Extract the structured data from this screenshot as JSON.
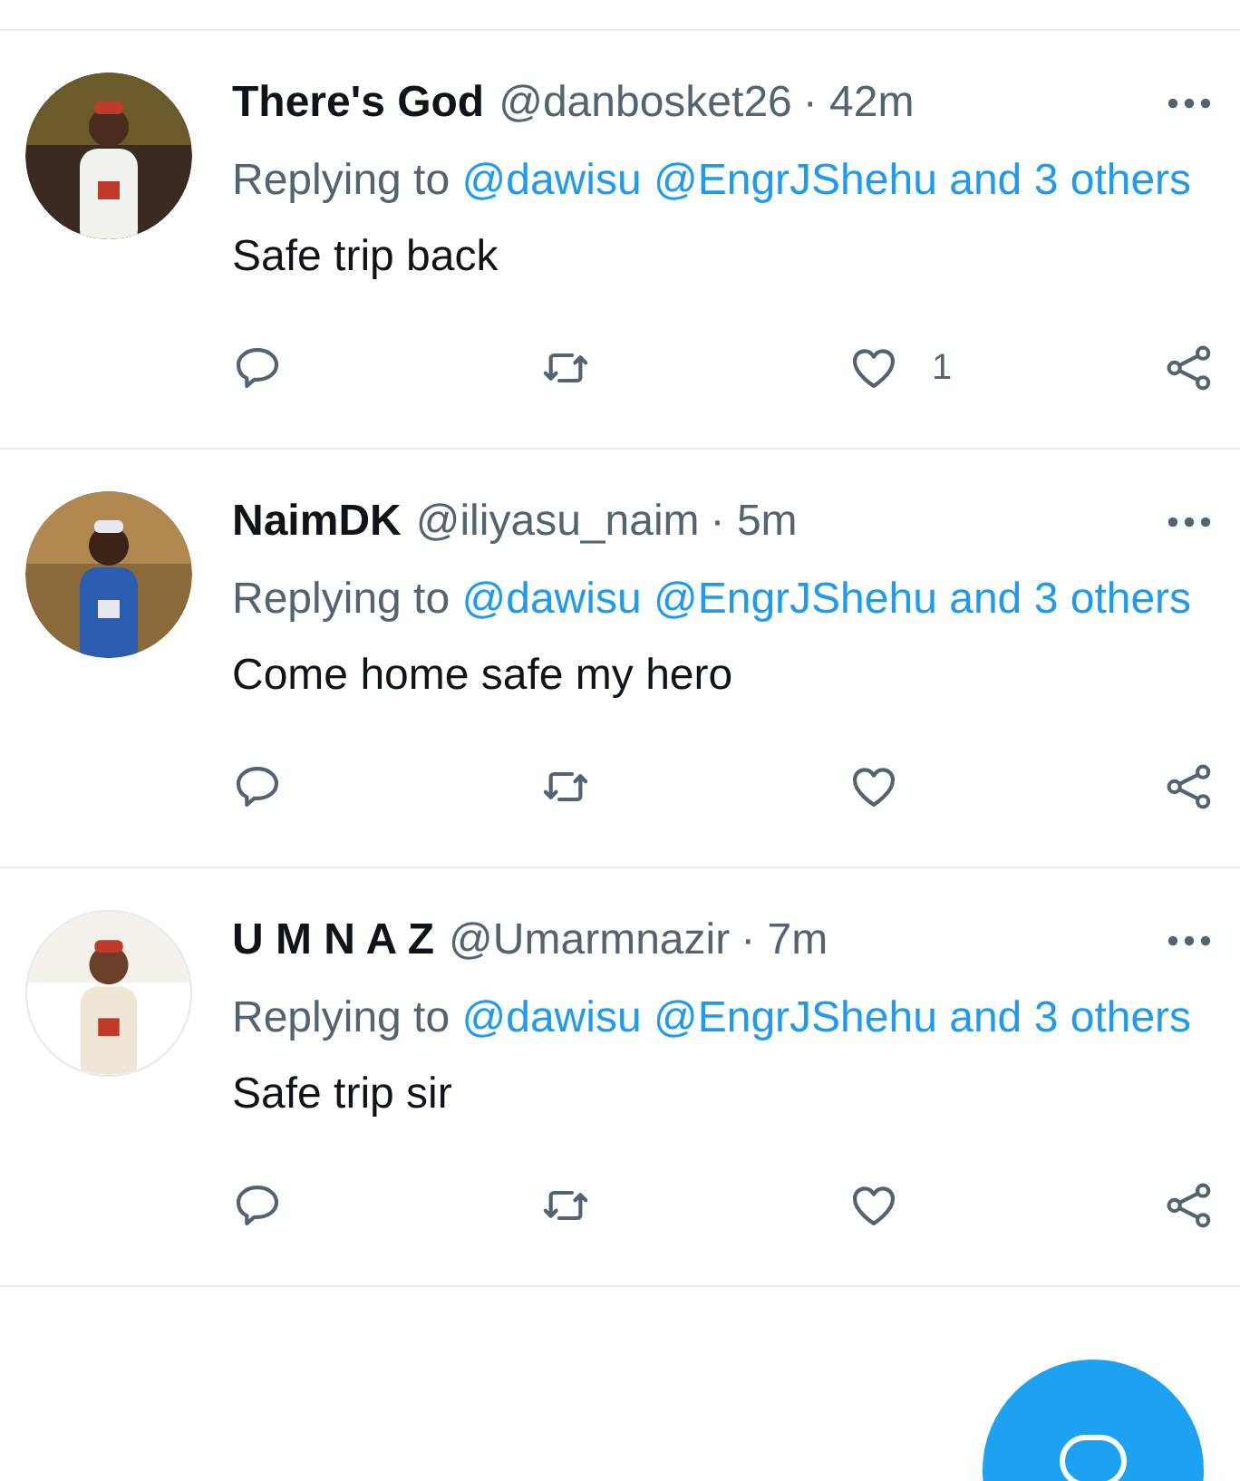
{
  "tweets": [
    {
      "name": "There's God",
      "handle": "@danbosket26",
      "time": "· 42m",
      "replying_prefix": "Replying to",
      "replying_to": "@dawisu @EngrJShehu and 3 others",
      "text": "Safe trip back",
      "like_count": "1"
    },
    {
      "name": "NaimDK",
      "handle": "@iliyasu_naim",
      "time": "· 5m",
      "replying_prefix": "Replying to",
      "replying_to": "@dawisu @EngrJShehu and 3 others",
      "text": "Come home safe my hero"
    },
    {
      "name": "U M N A Z",
      "handle": "@Umarmnazir",
      "time": "· 7m",
      "replying_prefix": "Replying to",
      "replying_to": "@dawisu @EngrJShehu and 3 others",
      "text": "Safe trip sir"
    }
  ]
}
